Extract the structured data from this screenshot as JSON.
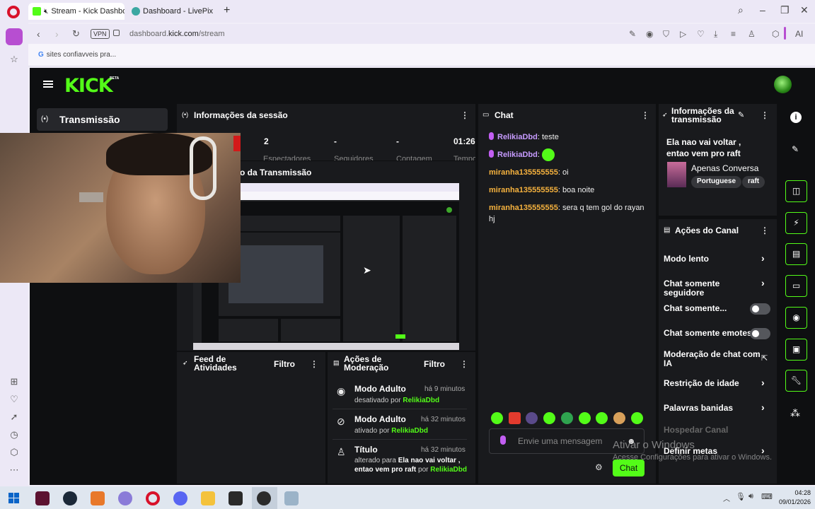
{
  "browser": {
    "tabs": [
      {
        "label": "Stream - Kick Dashbo",
        "favicon_color": "#53fc18"
      },
      {
        "label": "Dashboard - LivePix",
        "favicon_color": "#3ba7a2"
      }
    ],
    "url_prefix": "dashboard.",
    "url_domain": "kick.com",
    "url_path": "/stream",
    "vpn_label": "VPN",
    "ai_label": "AI",
    "bookmark": "sites confiavveis pra..."
  },
  "kick": {
    "logo": "KICK",
    "beta": "BETA",
    "nav_item": "Transmissão"
  },
  "session": {
    "title": "Informações da sessão",
    "stats": [
      {
        "value": "2",
        "label": "Espectadores"
      },
      {
        "value": "-",
        "label": "Seguidores"
      },
      {
        "value": "-",
        "label": "Contagem"
      },
      {
        "value": "01:26",
        "label": "Tempo"
      }
    ]
  },
  "preview": {
    "title": "Pré-visualização da Transmissão",
    "visible_title": "o da Transmissão"
  },
  "chat": {
    "title": "Chat",
    "messages": [
      {
        "user": "RelikiaDbd",
        "text": "teste",
        "badge": true,
        "color": "purple"
      },
      {
        "user": "RelikiaDbd",
        "text": "",
        "badge": true,
        "color": "purple",
        "emote": true
      },
      {
        "user": "miranha135555555",
        "text": "oi",
        "badge": false,
        "color": "orange"
      },
      {
        "user": "miranha135555555",
        "text": "boa noite",
        "badge": false,
        "color": "orange"
      },
      {
        "user": "miranha135555555",
        "text": "sera q tem gol do rayan hj",
        "badge": false,
        "color": "orange"
      }
    ],
    "placeholder": "Envie uma mensagem",
    "send_label": "Chat"
  },
  "info": {
    "title_line1": "Informações da",
    "title_line2": "transmissão",
    "stream_title": "Ela nao vai voltar , entao vem pro raft",
    "category": "Apenas Conversa",
    "tags": [
      "Portuguese",
      "raft"
    ]
  },
  "actions": {
    "title": "Ações do Canal",
    "items": [
      {
        "label": "Modo lento",
        "control": "chevron"
      },
      {
        "label": "Chat somente seguidore",
        "control": "chevron"
      },
      {
        "label": "Chat somente...",
        "control": "toggle"
      },
      {
        "label": "Chat somente emotes",
        "control": "toggle"
      },
      {
        "label": "Moderação de chat com IA",
        "control": "external"
      },
      {
        "label": "Restrição de idade",
        "control": "chevron"
      },
      {
        "label": "Palavras banidas",
        "control": "chevron"
      },
      {
        "label": "Hospedar Canal",
        "control": "disabled"
      },
      {
        "label": "Definir metas",
        "control": "chevron"
      }
    ]
  },
  "feed": {
    "title_line1": "Feed de",
    "title_line2": "Atividades",
    "filter": "Filtro"
  },
  "moderation": {
    "title_line1": "Ações de",
    "title_line2": "Moderação",
    "filter": "Filtro",
    "entries": [
      {
        "title": "Modo Adulto",
        "time": "há 9 minutos",
        "action": "desativado por",
        "extra": "",
        "by": "RelikiaDbd"
      },
      {
        "title": "Modo Adulto",
        "time": "há 32 minutos",
        "action": "ativado por",
        "extra": "",
        "by": "RelikiaDbd"
      },
      {
        "title": "Título",
        "time": "há 32 minutos",
        "action": "alterado para",
        "extra": "Ela nao vai voltar , entao vem pro raft",
        "by_prefix": "por",
        "by": "RelikiaDbd"
      }
    ]
  },
  "watermark": {
    "line1": "Ativar o Windows",
    "line2": "Acesse Configurações para ativar o Windows."
  },
  "taskbar": {
    "time": "04:28",
    "date": "09/01/2026"
  },
  "colors": {
    "kick_green": "#53fc18",
    "panel": "#191a1d",
    "background": "#0e0f11"
  }
}
